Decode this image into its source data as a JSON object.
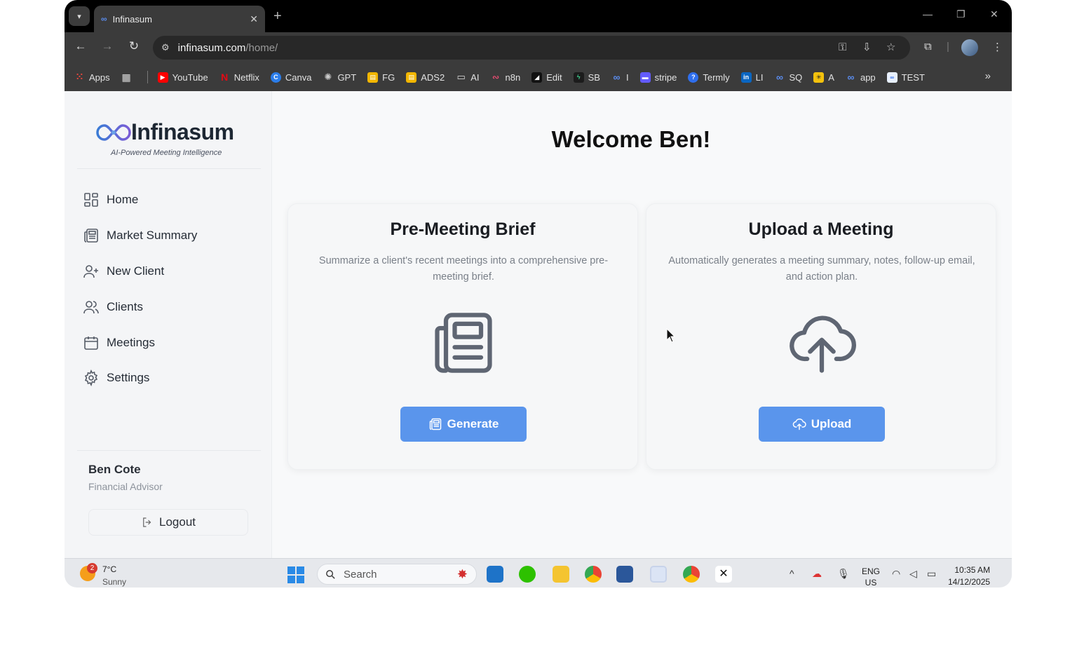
{
  "browser": {
    "tab_title": "Infinasum",
    "tab_favicon": "∞",
    "url_host": "infinasum.com",
    "url_path": "/home/",
    "bookmarks": [
      {
        "label": "Apps",
        "icon": "apps-grid-icon",
        "color": "#e8453c"
      },
      {
        "label": "",
        "icon": "grid-icon",
        "color": "#555555"
      },
      {
        "label": "YouTube",
        "icon": "youtube-icon",
        "color": "#ff0000"
      },
      {
        "label": "Netflix",
        "icon": "netflix-icon",
        "color": "#e50914"
      },
      {
        "label": "Canva",
        "icon": "canva-icon",
        "color": "#00c4cc"
      },
      {
        "label": "GPT",
        "icon": "gpt-icon",
        "color": "#222222"
      },
      {
        "label": "FG",
        "icon": "fg-icon",
        "color": "#f2b600"
      },
      {
        "label": "ADS2",
        "icon": "ads2-icon",
        "color": "#f2b600"
      },
      {
        "label": "AI",
        "icon": "folder-icon",
        "color": "#3b3b3b"
      },
      {
        "label": "n8n",
        "icon": "n8n-icon",
        "color": "#ea4b71"
      },
      {
        "label": "Edit",
        "icon": "edit-icon",
        "color": "#111111"
      },
      {
        "label": "SB",
        "icon": "sb-icon",
        "color": "#1f9d55"
      },
      {
        "label": "I",
        "icon": "infinity-icon",
        "color": "#3b3b3b"
      },
      {
        "label": "stripe",
        "icon": "stripe-icon",
        "color": "#635bff"
      },
      {
        "label": "Termly",
        "icon": "termly-icon",
        "color": "#2f6fed"
      },
      {
        "label": "LI",
        "icon": "linkedin-icon",
        "color": "#0a66c2"
      },
      {
        "label": "SQ",
        "icon": "infinity-icon",
        "color": "#3b3b3b"
      },
      {
        "label": "A",
        "icon": "a-icon",
        "color": "#f4c20d"
      },
      {
        "label": "app",
        "icon": "infinity-icon",
        "color": "#3b3b3b"
      },
      {
        "label": "TEST",
        "icon": "test-icon",
        "color": "#2f6fed"
      }
    ]
  },
  "sidebar": {
    "brand": "Infinasum",
    "tagline": "AI-Powered Meeting Intelligence",
    "items": [
      {
        "label": "Home",
        "icon": "home-grid-icon"
      },
      {
        "label": "Market Summary",
        "icon": "newspaper-icon"
      },
      {
        "label": "New Client",
        "icon": "user-plus-icon"
      },
      {
        "label": "Clients",
        "icon": "users-icon"
      },
      {
        "label": "Meetings",
        "icon": "calendar-icon"
      },
      {
        "label": "Settings",
        "icon": "gear-icon"
      }
    ],
    "user_name": "Ben Cote",
    "user_role": "Financial Advisor",
    "logout_label": "Logout"
  },
  "main": {
    "welcome": "Welcome Ben!",
    "cards": [
      {
        "title": "Pre-Meeting Brief",
        "description": "Summarize a client's recent meetings into a comprehensive pre-meeting brief.",
        "icon": "newspaper-icon",
        "button_label": "Generate"
      },
      {
        "title": "Upload a Meeting",
        "description": "Automatically generates a meeting summary, notes, follow-up email, and action plan.",
        "icon": "cloud-upload-icon",
        "button_label": "Upload"
      }
    ],
    "accent_color": "#5a95ec"
  },
  "taskbar": {
    "weather_badge": "2",
    "temperature": "7°C",
    "weather_desc": "Sunny",
    "search_placeholder": "Search",
    "lang_top": "ENG",
    "lang_bottom": "US",
    "time": "10:35 AM",
    "date": "14/12/2025"
  }
}
